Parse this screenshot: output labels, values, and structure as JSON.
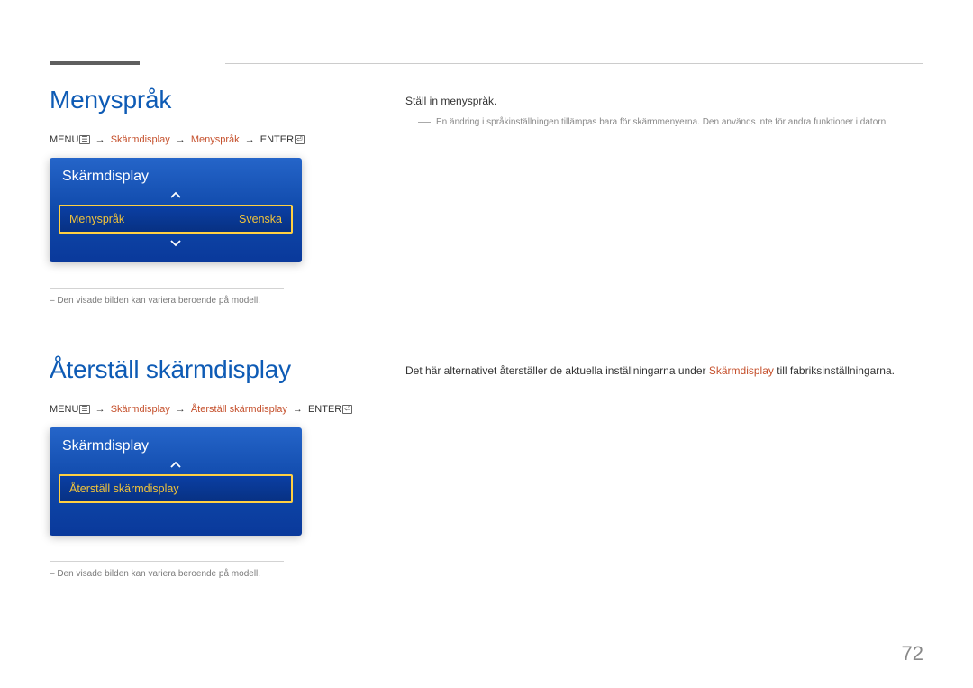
{
  "page_number": "72",
  "section1": {
    "heading": "Menyspråk",
    "path": {
      "menu": "MENU",
      "p1": "Skärmdisplay",
      "p2": "Menyspråk",
      "enter": "ENTER"
    },
    "osd": {
      "title": "Skärmdisplay",
      "row_label": "Menyspråk",
      "row_value": "Svenska"
    },
    "footnote": "–  Den visade bilden kan variera beroende på modell.",
    "right": {
      "intro": "Ställ in menyspråk.",
      "note": "En ändring i språkinställningen tillämpas bara för skärmmenyerna. Den används inte för andra funktioner i datorn."
    }
  },
  "section2": {
    "heading": "Återställ skärmdisplay",
    "path": {
      "menu": "MENU",
      "p1": "Skärmdisplay",
      "p2": "Återställ skärmdisplay",
      "enter": "ENTER"
    },
    "osd": {
      "title": "Skärmdisplay",
      "row_label": "Återställ skärmdisplay"
    },
    "footnote": "–  Den visade bilden kan variera beroende på modell.",
    "right": {
      "text_before": "Det här alternativet återställer de aktuella inställningarna under ",
      "text_hl": "Skärmdisplay",
      "text_after": " till fabriksinställningarna."
    }
  }
}
